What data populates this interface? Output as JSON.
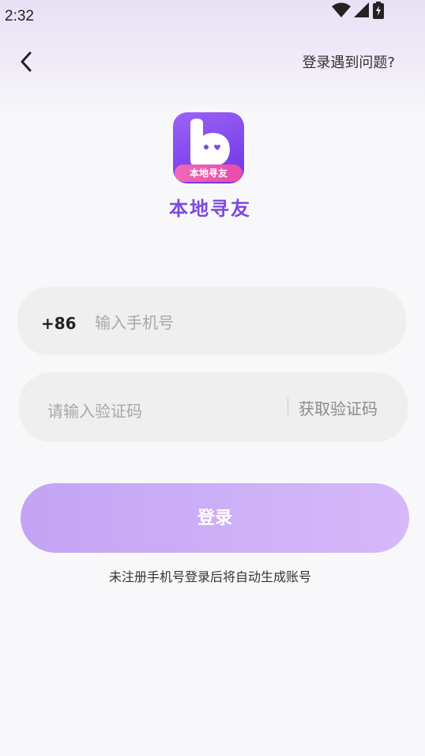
{
  "status_bar": {
    "time": "2:32",
    "icons": [
      "wifi-icon",
      "signal-icon",
      "battery-icon"
    ]
  },
  "nav": {
    "back_icon": "chevron-left-icon",
    "help_link": "登录遇到问题?"
  },
  "app": {
    "name": "本地寻友",
    "logo_badge": "本地寻友",
    "colors": {
      "brand": "#7b4ae0",
      "logo_pink": "#e94aa9"
    }
  },
  "form": {
    "country_code": "+86",
    "phone_placeholder": "输入手机号",
    "phone_value": "",
    "code_placeholder": "请输入验证码",
    "code_value": "",
    "get_code_label": "获取验证码"
  },
  "login_button": {
    "label": "登录",
    "color": "#d0b3f7"
  },
  "note": "未注册手机号登录后将自动生成账号"
}
